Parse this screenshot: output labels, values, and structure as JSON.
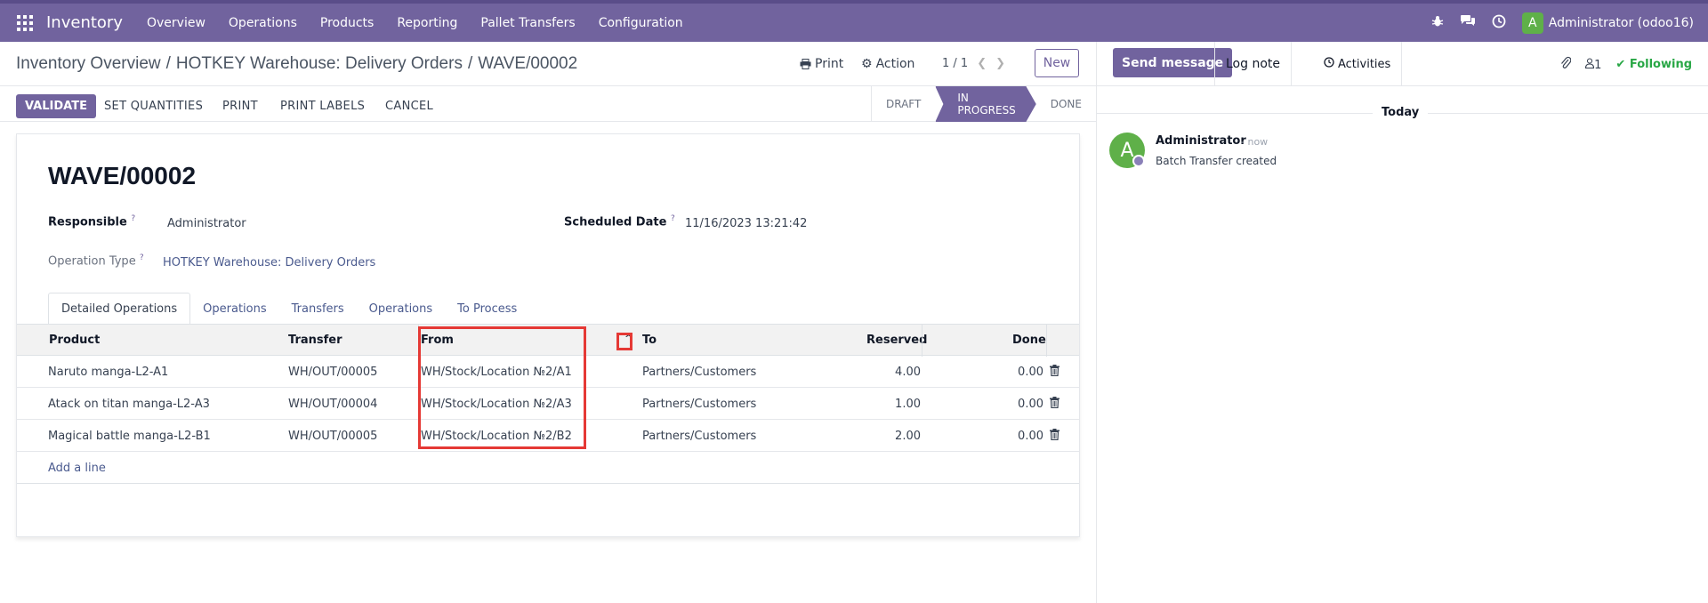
{
  "topbar": {
    "brand": "Inventory",
    "menu": [
      "Overview",
      "Operations",
      "Products",
      "Reporting",
      "Pallet Transfers",
      "Configuration"
    ],
    "user": {
      "initial": "A",
      "name": "Administrator (odoo16)"
    }
  },
  "control_panel": {
    "breadcrumb": [
      "Inventory Overview",
      "HOTKEY Warehouse: Delivery Orders",
      "WAVE/00002"
    ],
    "print_label": "Print",
    "action_label": "Action",
    "pager": "1 / 1",
    "new_label": "New"
  },
  "buttons": {
    "validate": "VALIDATE",
    "set_quantities": "SET QUANTITIES",
    "print": "PRINT",
    "print_labels": "PRINT LABELS",
    "cancel": "CANCEL"
  },
  "statusbar": [
    "DRAFT",
    "IN PROGRESS",
    "DONE"
  ],
  "record": {
    "name": "WAVE/00002",
    "responsible_label": "Responsible",
    "responsible": "Administrator",
    "scheduled_label": "Scheduled Date",
    "scheduled": "11/16/2023 13:21:42",
    "operation_type_label": "Operation Type",
    "operation_type": "HOTKEY Warehouse: Delivery Orders",
    "help": "?"
  },
  "tabs": [
    "Detailed Operations",
    "Operations",
    "Transfers",
    "Operations",
    "To Process"
  ],
  "table": {
    "headers": {
      "product": "Product",
      "transfer": "Transfer",
      "from": "From",
      "to": "To",
      "reserved": "Reserved",
      "done": "Done"
    },
    "rows": [
      {
        "product": "Naruto manga-L2-A1",
        "transfer": "WH/OUT/00005",
        "from": "WH/Stock/Location №2/A1",
        "to": "Partners/Customers",
        "reserved": "4.00",
        "done": "0.00"
      },
      {
        "product": "Atack on titan manga-L2-A3",
        "transfer": "WH/OUT/00004",
        "from": "WH/Stock/Location №2/A3",
        "to": "Partners/Customers",
        "reserved": "1.00",
        "done": "0.00"
      },
      {
        "product": "Magical battle manga-L2-B1",
        "transfer": "WH/OUT/00005",
        "from": "WH/Stock/Location №2/B2",
        "to": "Partners/Customers",
        "reserved": "2.00",
        "done": "0.00"
      }
    ],
    "add_line": "Add a line"
  },
  "chatter": {
    "send_message": "Send message",
    "log_note": "Log note",
    "activities": "Activities",
    "followers_count": "1",
    "following": "Following",
    "today": "Today",
    "message": {
      "initial": "A",
      "author": "Administrator",
      "time": "- now",
      "body": "Batch Transfer created"
    }
  }
}
